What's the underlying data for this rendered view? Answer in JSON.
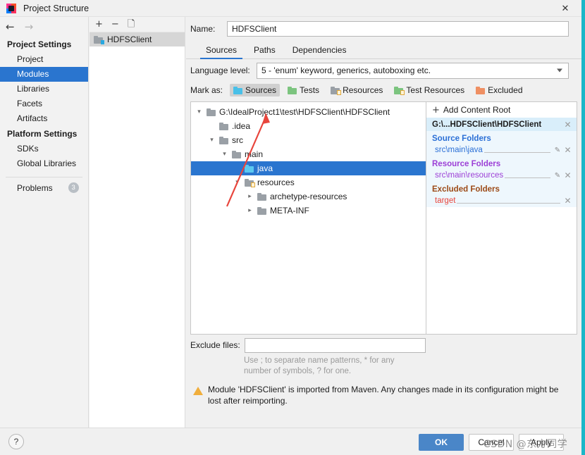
{
  "window": {
    "title": "Project Structure",
    "logo_icon": "intellij-idea-logo",
    "close_icon": "✕"
  },
  "nav": {
    "back_icon": "←",
    "forward_icon": "→"
  },
  "sidebar": {
    "groups": [
      {
        "label": "Project Settings",
        "items": [
          {
            "label": "Project",
            "selected": false
          },
          {
            "label": "Modules",
            "selected": true
          },
          {
            "label": "Libraries",
            "selected": false
          },
          {
            "label": "Facets",
            "selected": false
          },
          {
            "label": "Artifacts",
            "selected": false
          }
        ]
      },
      {
        "label": "Platform Settings",
        "items": [
          {
            "label": "SDKs",
            "selected": false
          },
          {
            "label": "Global Libraries",
            "selected": false
          }
        ]
      }
    ],
    "problems": {
      "label": "Problems",
      "count": "3"
    }
  },
  "modules_panel": {
    "toolbar": {
      "add_icon": "+",
      "remove_icon": "−",
      "copy_icon": "copy-icon"
    },
    "items": [
      {
        "label": "HDFSClient",
        "selected": true
      }
    ]
  },
  "module": {
    "name_label": "Name:",
    "name_mnemonic": "m",
    "name_value": "HDFSClient",
    "tabs": [
      {
        "label": "Sources",
        "active": true
      },
      {
        "label": "Paths",
        "active": false
      },
      {
        "label": "Dependencies",
        "active": false
      }
    ],
    "language_level": {
      "label": "Language level:",
      "value": "5 - 'enum' keyword, generics, autoboxing etc."
    },
    "mark_as": {
      "label": "Mark as:",
      "options": [
        {
          "label": "Sources",
          "icon": "folder-blue-icon",
          "selected": true
        },
        {
          "label": "Tests",
          "icon": "folder-green-icon",
          "selected": false
        },
        {
          "label": "Resources",
          "icon": "folder-resources-icon",
          "selected": false
        },
        {
          "label": "Test Resources",
          "icon": "folder-test-resources-icon",
          "selected": false
        },
        {
          "label": "Excluded",
          "icon": "folder-orange-icon",
          "selected": false
        }
      ]
    }
  },
  "tree": {
    "nodes": [
      {
        "label": "G:\\IdealProject1\\test\\HDFSClient\\HDFSClient",
        "indent": 0,
        "twisty": "expanded",
        "icon": "folder-gray-icon",
        "selected": false
      },
      {
        "label": ".idea",
        "indent": 1,
        "twisty": "none",
        "icon": "folder-gray-icon",
        "selected": false
      },
      {
        "label": "src",
        "indent": 1,
        "twisty": "expanded",
        "icon": "folder-gray-icon",
        "selected": false
      },
      {
        "label": "main",
        "indent": 2,
        "twisty": "expanded",
        "icon": "folder-gray-icon",
        "selected": false
      },
      {
        "label": "java",
        "indent": 3,
        "twisty": "none",
        "icon": "folder-blue-icon",
        "selected": true
      },
      {
        "label": "resources",
        "indent": 3,
        "twisty": "expanded",
        "icon": "folder-resources-icon",
        "selected": false
      },
      {
        "label": "archetype-resources",
        "indent": 4,
        "twisty": "collapsed",
        "icon": "folder-gray-icon",
        "selected": false
      },
      {
        "label": "META-INF",
        "indent": 4,
        "twisty": "collapsed",
        "icon": "folder-gray-icon",
        "selected": false
      }
    ]
  },
  "content_roots": {
    "add_label": "Add Content Root",
    "add_mnemonic": "C",
    "add_icon": "+",
    "root_path": "G:\\...HDFSClient\\HDFSClient",
    "root_remove_icon": "✕",
    "sections": [
      {
        "title": "Source Folders",
        "color": "#2a6fd6",
        "entries": [
          {
            "path": "src\\main\\java",
            "has_edit": true,
            "edit_icon": "pencil-icon",
            "remove_icon": "✕"
          }
        ]
      },
      {
        "title": "Resource Folders",
        "color": "#9c3fd6",
        "entries": [
          {
            "path": "src\\main\\resources",
            "has_edit": true,
            "edit_icon": "pencil-icon",
            "remove_icon": "✕"
          }
        ]
      },
      {
        "title": "Excluded Folders",
        "color": "#9c4a17",
        "entries": [
          {
            "path": "target",
            "has_edit": false,
            "edit_icon": "",
            "remove_icon": "✕"
          }
        ]
      }
    ]
  },
  "exclude_files": {
    "label": "Exclude files:",
    "value": "",
    "hint_line1": "Use ; to separate name patterns, * for any",
    "hint_line2": "number of symbols, ? for one."
  },
  "warning": {
    "icon": "warning-triangle-icon",
    "line1": "Module 'HDFSClient' is imported from Maven. Any changes made in its configuration might be lost",
    "line2": "after reimporting."
  },
  "footer": {
    "help_label": "?",
    "ok_label": "OK",
    "cancel_label": "Cancel",
    "apply_label": "Apply"
  },
  "overlay": {
    "annotation_arrow": "red-arrow-annotation",
    "watermark_text": "CSDN @东方同学"
  },
  "colors": {
    "accent_blue": "#2a75cf",
    "ok_button": "#4a86c8",
    "right_border": "#1ab7c8",
    "source_folder": "#2a6fd6",
    "resource_folder": "#9c3fd6",
    "excluded_folder": "#e8453c",
    "annotation_red": "#e8453c"
  }
}
